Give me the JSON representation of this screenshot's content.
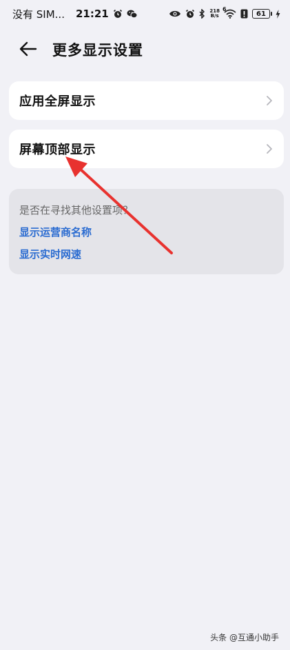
{
  "status_bar": {
    "carrier": "没有 SIM...",
    "time": "21:21",
    "net_speed_value": "218",
    "net_speed_unit": "B/s",
    "wifi_label": "6",
    "battery": "61",
    "icons": [
      "alarm-icon",
      "wechat-icon",
      "eye-icon",
      "alarm-icon",
      "bluetooth-icon",
      "wifi-icon",
      "alert-icon",
      "battery-icon",
      "charging-icon"
    ]
  },
  "header": {
    "title": "更多显示设置"
  },
  "settings": {
    "items": [
      {
        "label": "应用全屏显示"
      },
      {
        "label": "屏幕顶部显示"
      }
    ]
  },
  "suggestions": {
    "question": "是否在寻找其他设置项？",
    "links": [
      "显示运营商名称",
      "显示实时网速"
    ]
  },
  "annotation": {
    "color": "#e8322f"
  },
  "watermark": "头条 @互通小助手",
  "colors": {
    "background": "#f1f1f6",
    "card": "#ffffff",
    "suggest_card": "#e4e4e9",
    "link": "#2b6cd1"
  }
}
